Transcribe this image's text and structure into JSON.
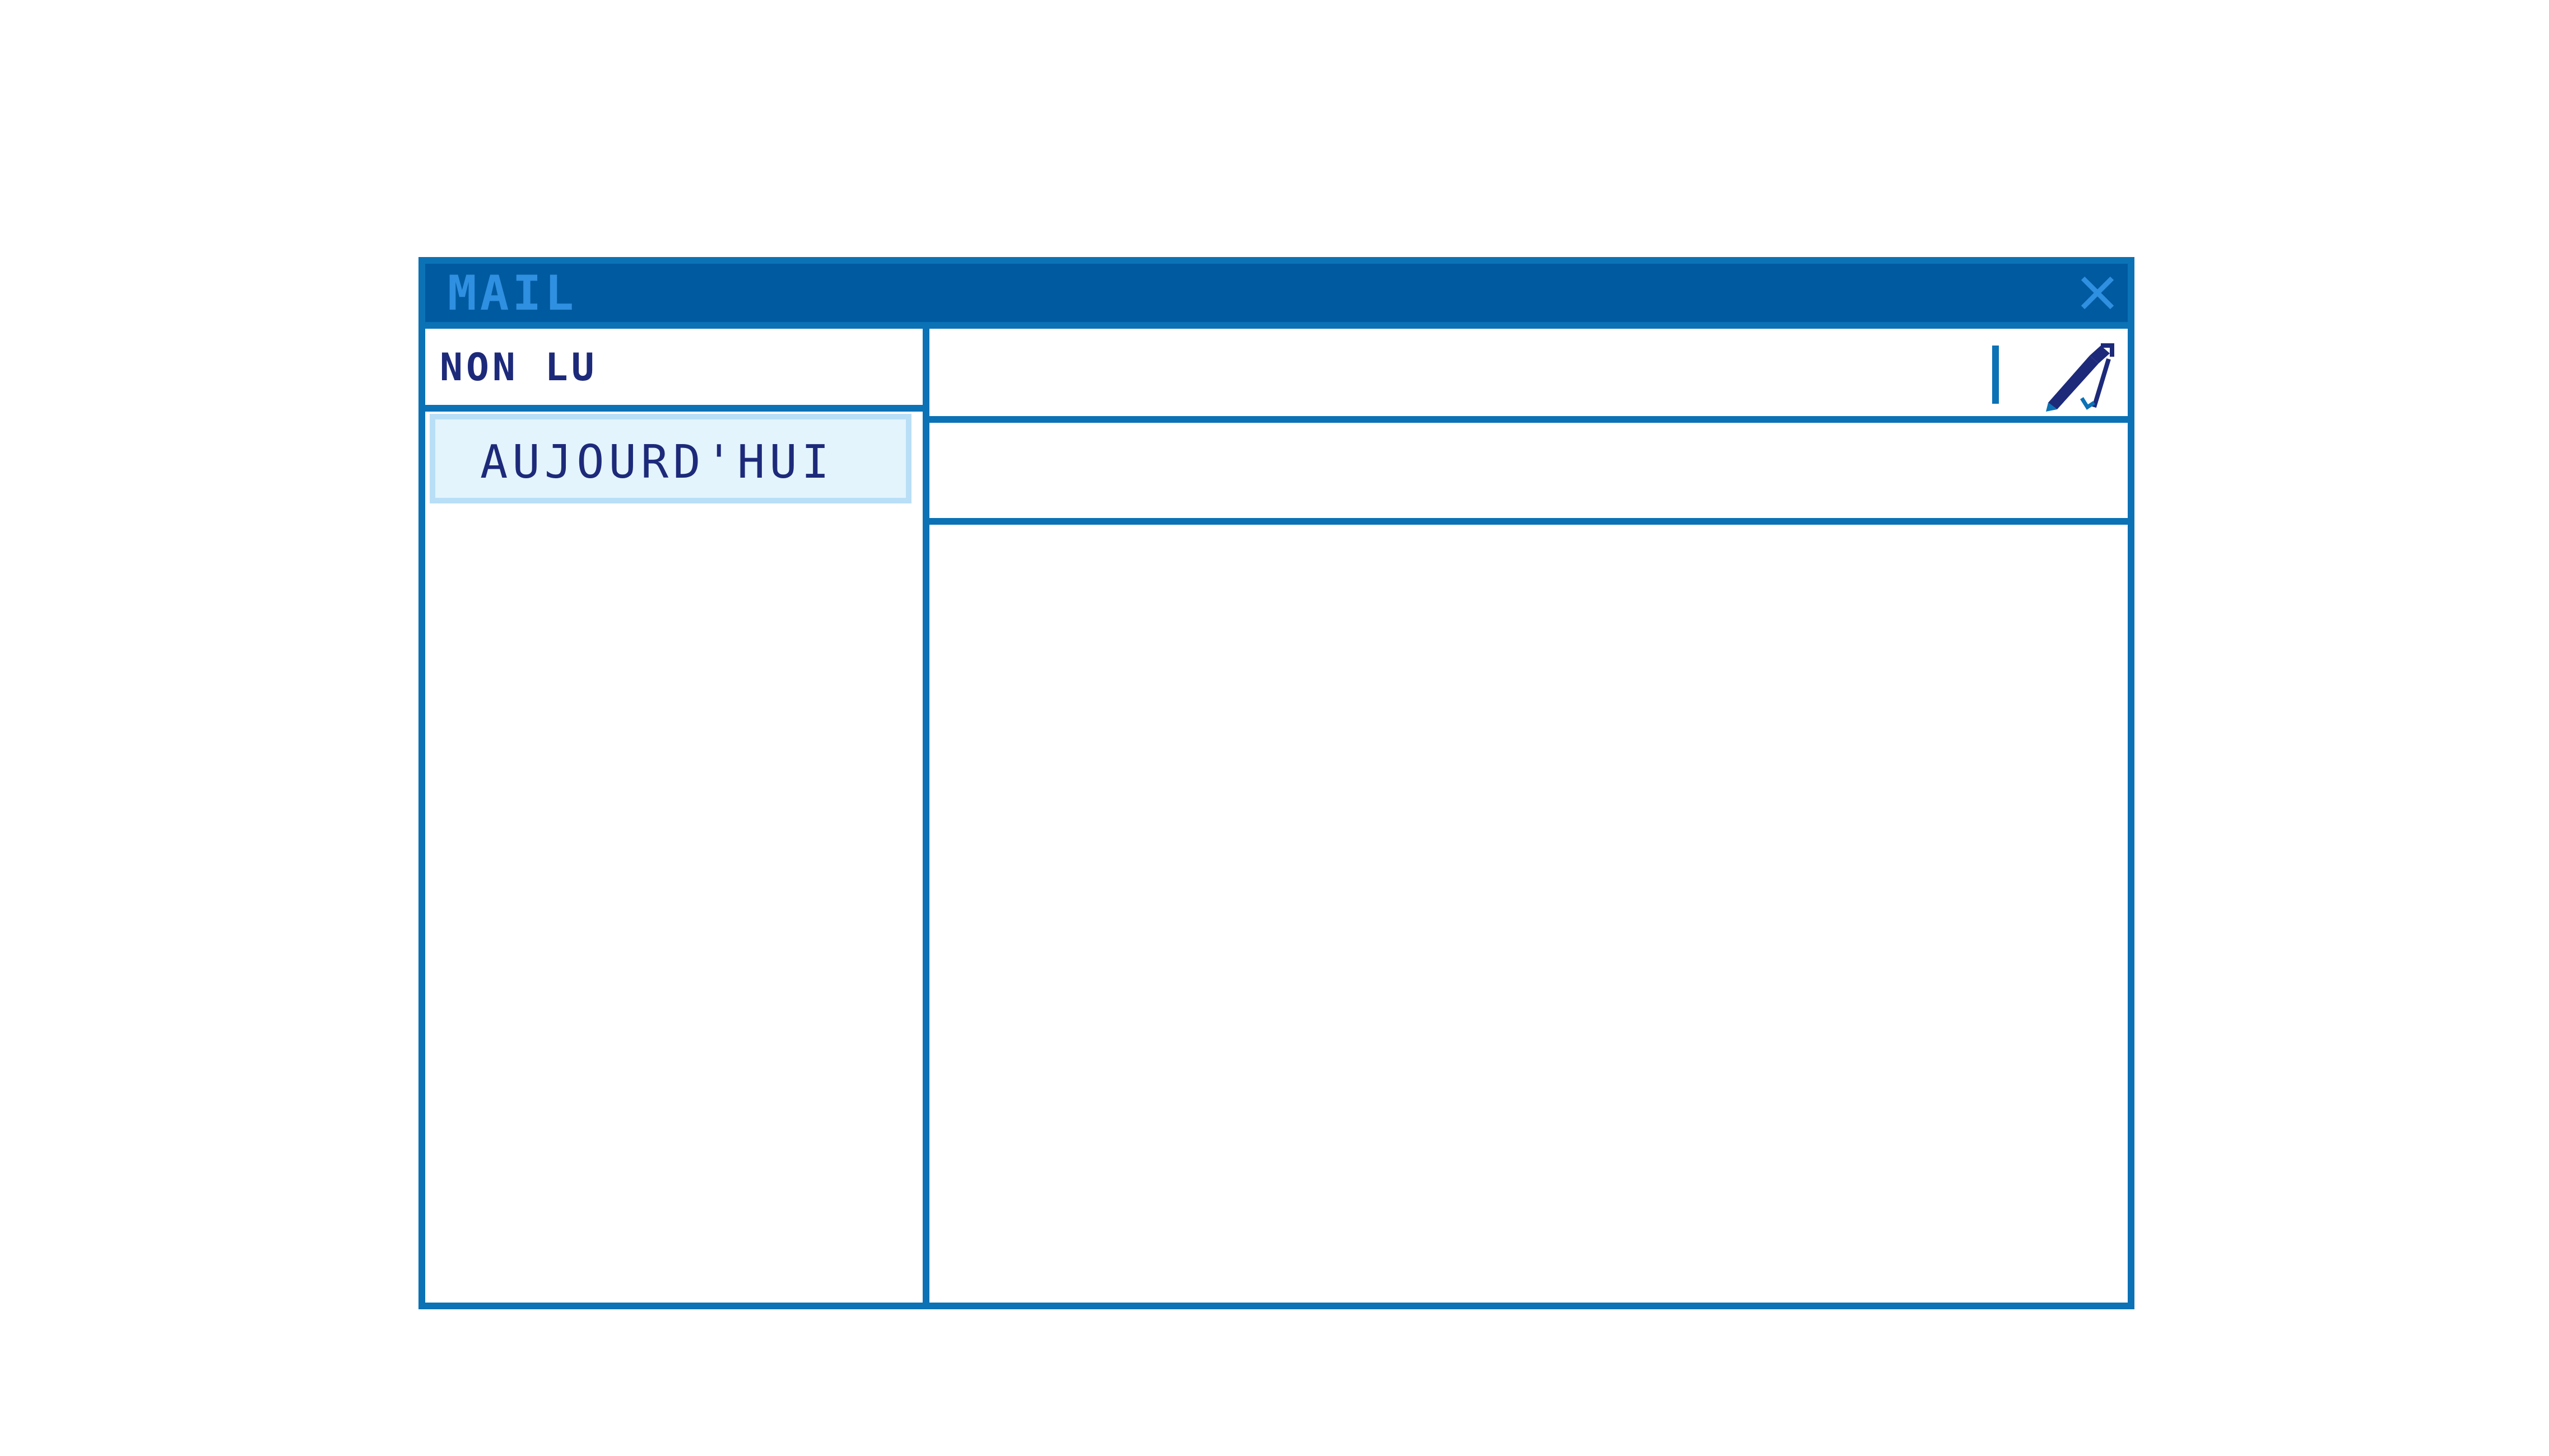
{
  "window": {
    "title": "MAIL"
  },
  "sidebar": {
    "header_label": "NON LU",
    "items": [
      {
        "label": "AUJOURD'HUI"
      }
    ]
  },
  "content": {
    "subject": "",
    "body": ""
  },
  "icons": {
    "close": "close-icon",
    "compose": "pencil-icon"
  },
  "colors": {
    "border": "#0b72b6",
    "titlebar": "#005aa0",
    "title_text": "#2f8fe0",
    "text": "#1d2a7a",
    "selected_bg": "#e3f4fd",
    "selected_border": "#b9dff7"
  }
}
